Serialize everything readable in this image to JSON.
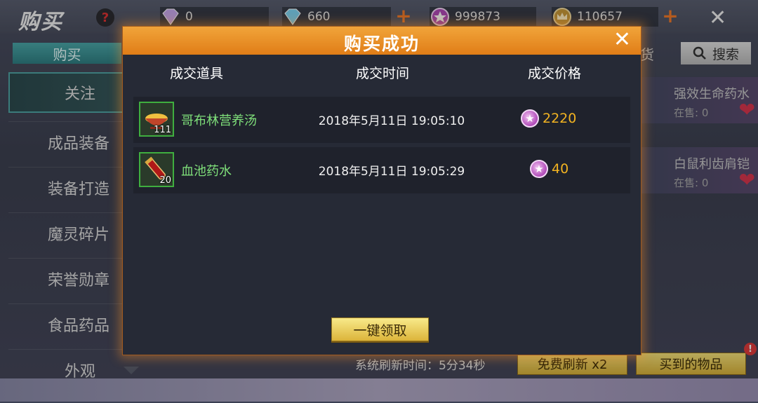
{
  "header": {
    "title": "购买",
    "help_icon": "?",
    "currencies": [
      {
        "icon": "diamond-purple",
        "value": "0"
      },
      {
        "icon": "diamond-blue",
        "value": "660"
      },
      {
        "icon": "star-coin",
        "value": "999873"
      },
      {
        "icon": "crown-coin",
        "value": "110657"
      }
    ],
    "plus": "+",
    "close": "✕"
  },
  "sidebar": {
    "top_tab": "购买",
    "items": [
      {
        "label": "关注"
      },
      {
        "label": "成品装备"
      },
      {
        "label": "装备打造"
      },
      {
        "label": "魔灵碎片"
      },
      {
        "label": "荣誉勋章"
      },
      {
        "label": "食品药品"
      },
      {
        "label": "外观"
      }
    ]
  },
  "background_list": {
    "search_label": "搜索",
    "tab_partial": "货",
    "cards": [
      {
        "name": "强效生命药水",
        "stock": "在售: 0"
      },
      {
        "name": "白鼠利齿肩铠",
        "stock": "在售: 0"
      }
    ]
  },
  "footer": {
    "refresh_text": "系统刷新时间：5分34秒",
    "free_refresh": "免费刷新 x2",
    "bought_items": "买到的物品",
    "alert": "!"
  },
  "dialog": {
    "title": "购买成功",
    "close": "✕",
    "columns": [
      "成交道具",
      "成交时间",
      "成交价格"
    ],
    "rows": [
      {
        "icon": "soup-bowl-icon",
        "count": "111",
        "name": "哥布林营养汤",
        "time": "2018年5月11日 19:05:10",
        "price": "2220"
      },
      {
        "icon": "red-potion-icon",
        "count": "20",
        "name": "血池药水",
        "time": "2018年5月11日 19:05:29",
        "price": "40"
      }
    ],
    "claim_button": "一键领取"
  },
  "colors": {
    "dialog_header": "#e8901f",
    "item_name": "#7fe07a",
    "price": "#f2b321",
    "accent_teal": "#4aa7a8"
  }
}
